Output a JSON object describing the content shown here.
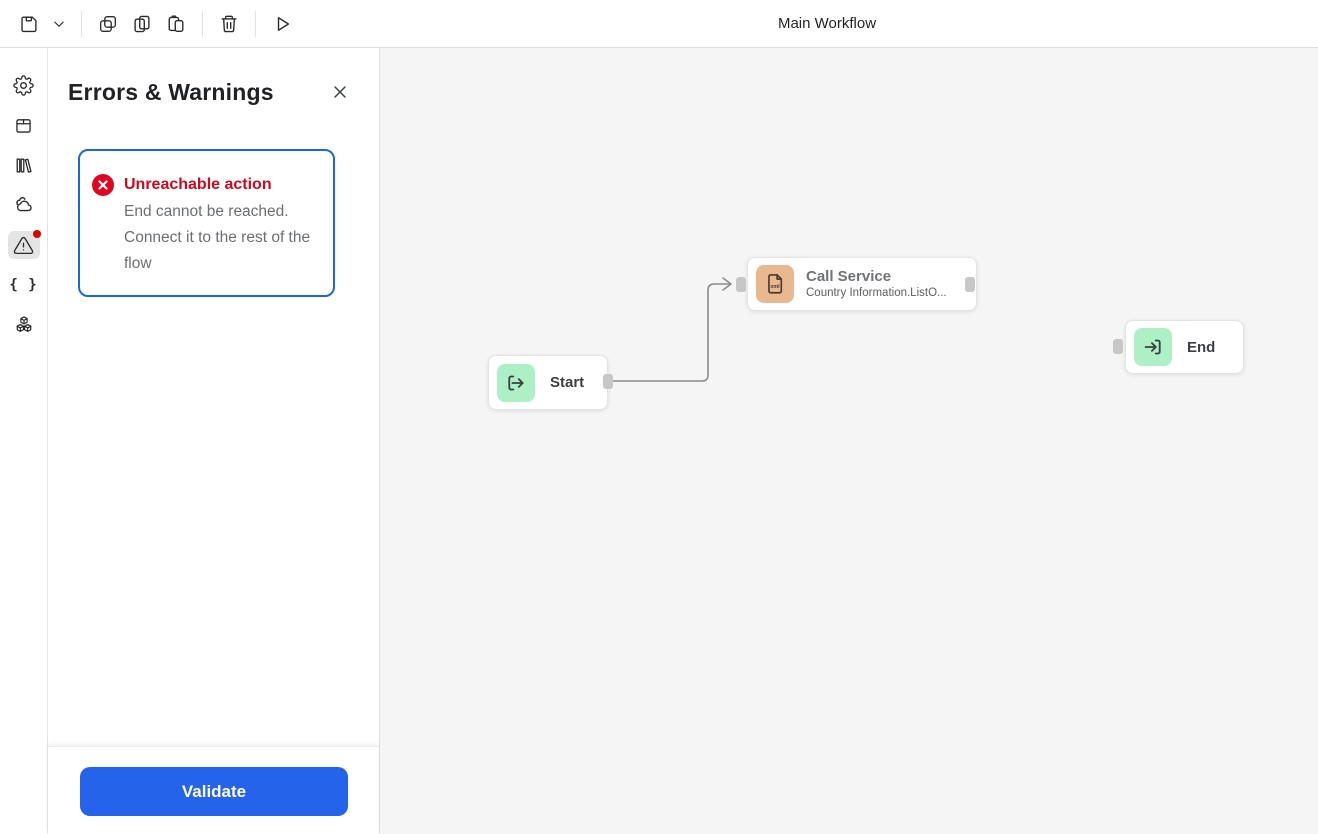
{
  "header": {
    "title": "Main Workflow",
    "toolbar_icons": [
      "save",
      "chevron-down",
      "duplicate",
      "copy",
      "paste",
      "delete",
      "run"
    ]
  },
  "sidebar": {
    "items": [
      {
        "icon": "settings",
        "active": false
      },
      {
        "icon": "package",
        "active": false
      },
      {
        "icon": "library",
        "active": false
      },
      {
        "icon": "clouds",
        "active": false
      },
      {
        "icon": "warnings",
        "active": true,
        "badge": true
      },
      {
        "icon": "braces",
        "active": false,
        "glyph": "{ }"
      },
      {
        "icon": "modules",
        "active": false
      }
    ]
  },
  "panel": {
    "title": "Errors & Warnings",
    "errors": [
      {
        "severity": "error",
        "title": "Unreachable action",
        "message": "End cannot be reached. Connect it to the rest of the flow"
      }
    ],
    "validate_button": "Validate"
  },
  "canvas": {
    "nodes": [
      {
        "id": "start",
        "title": "Start",
        "icon": "flow-start"
      },
      {
        "id": "call-service",
        "title": "Call Service",
        "subtitle": "Country Information.ListO...",
        "icon": "xml-document",
        "icon_label": "xml"
      },
      {
        "id": "end",
        "title": "End",
        "icon": "flow-end"
      }
    ],
    "edges": [
      {
        "from": "start",
        "to": "call-service"
      }
    ]
  },
  "colors": {
    "accent_blue": "#2563eb",
    "selection_blue": "#1b66e8",
    "error_red": "#d2071d",
    "badge_red": "#e1061f",
    "node_green": "#aef0c6",
    "node_orange": "#eab890",
    "canvas_bg": "#f5f5f6",
    "connector_gray": "#8c8c8c"
  }
}
